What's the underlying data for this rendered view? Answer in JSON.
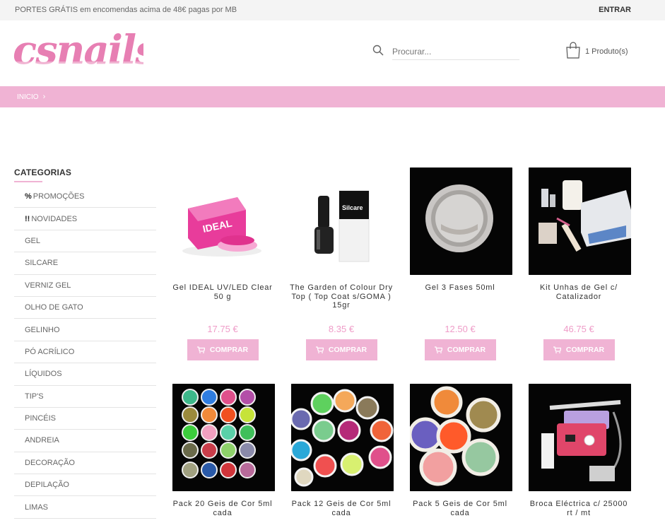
{
  "topbar": {
    "promo": "PORTES GRÁTIS em encomendas acima de 48€ pagas por MB",
    "login": "ENTRAR"
  },
  "header": {
    "logo": "csnails",
    "search_placeholder": "Procurar...",
    "cart_label": "1 Produto(s)"
  },
  "breadcrumb": {
    "home": "INICIO"
  },
  "sidebar": {
    "title": "CATEGORIAS",
    "items": [
      {
        "prefix": "%",
        "label": "PROMOÇÕES"
      },
      {
        "prefix": "!!",
        "label": "NOVIDADES"
      },
      {
        "prefix": "",
        "label": "GEL"
      },
      {
        "prefix": "",
        "label": "SILCARE"
      },
      {
        "prefix": "",
        "label": "VERNIZ GEL"
      },
      {
        "prefix": "",
        "label": "OLHO DE GATO"
      },
      {
        "prefix": "",
        "label": "GELINHO"
      },
      {
        "prefix": "",
        "label": "PÓ ACRÍLICO"
      },
      {
        "prefix": "",
        "label": "LÍQUIDOS"
      },
      {
        "prefix": "",
        "label": "TIP'S"
      },
      {
        "prefix": "",
        "label": "PINCÉIS"
      },
      {
        "prefix": "",
        "label": "ANDREIA"
      },
      {
        "prefix": "",
        "label": "DECORAÇÃO"
      },
      {
        "prefix": "",
        "label": "DEPILAÇÃO"
      },
      {
        "prefix": "",
        "label": "LIMAS"
      }
    ]
  },
  "products": [
    {
      "name": "Gel IDEAL UV/LED Clear 50 g",
      "price": "17.75 €",
      "buy": "COMPRAR"
    },
    {
      "name": "The Garden of Colour Dry Top ( Top Coat s/GOMA ) 15gr",
      "price": "8.35 €",
      "buy": "COMPRAR"
    },
    {
      "name": "Gel 3 Fases 50ml",
      "price": "12.50 €",
      "buy": "COMPRAR"
    },
    {
      "name": "Kit Unhas de Gel c/ Catalizador",
      "price": "46.75 €",
      "buy": "COMPRAR"
    },
    {
      "name": "Pack 20 Geis de Cor 5ml cada",
      "price": "",
      "buy": ""
    },
    {
      "name": "Pack 12 Geis de Cor 5ml cada",
      "price": "",
      "buy": ""
    },
    {
      "name": "Pack 5 Geis de Cor 5ml cada",
      "price": "",
      "buy": ""
    },
    {
      "name": "Broca Eléctrica c/ 25000 rt / mt",
      "price": "",
      "buy": ""
    }
  ],
  "product_image_text": {
    "ideal_jar": "IDEAL",
    "silcare_box": "Silcare"
  },
  "colors": {
    "accent": "#f0b3d4",
    "price": "#ef9cc8",
    "logo": "#e77fb3"
  }
}
